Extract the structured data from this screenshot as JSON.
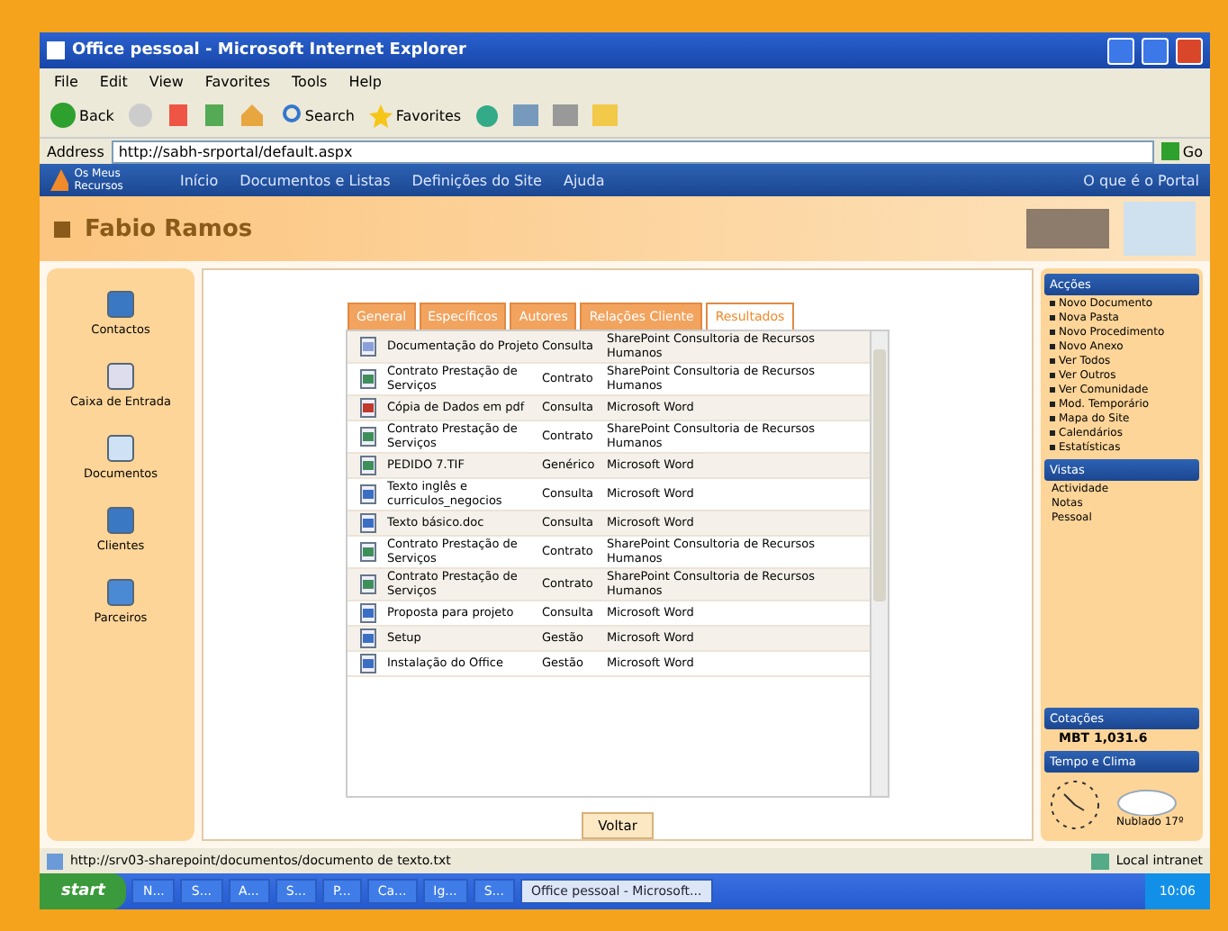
{
  "window": {
    "title": "Office pessoal - Microsoft Internet Explorer"
  },
  "menu": [
    "File",
    "Edit",
    "View",
    "Favorites",
    "Tools",
    "Help"
  ],
  "toolbar": {
    "back": "Back",
    "search": "Search",
    "favorites": "Favorites"
  },
  "address": {
    "label": "Address",
    "value": "http://sabh-srportal/default.aspx",
    "go": "Go"
  },
  "site_nav": {
    "logo": "Os Meus Recursos",
    "items": [
      "Início",
      "Documentos e Listas",
      "Definições do Site",
      "Ajuda"
    ],
    "right": "O que é o Portal"
  },
  "header": {
    "user": "Fabio Ramos"
  },
  "sidebar": {
    "items": [
      "Contactos",
      "Caixa de Entrada",
      "Documentos",
      "Clientes",
      "Parceiros"
    ]
  },
  "tabs": [
    {
      "label": "General",
      "selected": false
    },
    {
      "label": "Específicos",
      "selected": false
    },
    {
      "label": "Autores",
      "selected": false
    },
    {
      "label": "Relações Cliente",
      "selected": false
    },
    {
      "label": "Resultados",
      "selected": true
    }
  ],
  "results": [
    {
      "kind": "flag",
      "name": "Documentação do Projeto",
      "type": "Consulta",
      "source": "SharePoint Consultoria de Recursos Humanos"
    },
    {
      "kind": "sheet",
      "name": "Contrato Prestação de Serviços",
      "type": "Contrato",
      "source": "SharePoint Consultoria de Recursos Humanos"
    },
    {
      "kind": "pdf",
      "name": "Cópia de Dados em pdf",
      "type": "Consulta",
      "source": "Microsoft Word"
    },
    {
      "kind": "sheet",
      "name": "Contrato Prestação de Serviços",
      "type": "Contrato",
      "source": "SharePoint Consultoria de Recursos Humanos"
    },
    {
      "kind": "sheet",
      "name": "PEDIDO 7.TIF",
      "type": "Genérico",
      "source": "Microsoft Word"
    },
    {
      "kind": "doc",
      "name": "Texto inglês e curriculos_negocios",
      "type": "Consulta",
      "source": "Microsoft Word"
    },
    {
      "kind": "doc",
      "name": "Texto básico.doc",
      "type": "Consulta",
      "source": "Microsoft Word"
    },
    {
      "kind": "sheet",
      "name": "Contrato Prestação de Serviços",
      "type": "Contrato",
      "source": "SharePoint Consultoria de Recursos Humanos"
    },
    {
      "kind": "sheet",
      "name": "Contrato Prestação de Serviços",
      "type": "Contrato",
      "source": "SharePoint Consultoria de Recursos Humanos"
    },
    {
      "kind": "doc",
      "name": "Proposta para projeto",
      "type": "Consulta",
      "source": "Microsoft Word"
    },
    {
      "kind": "doc",
      "name": "Setup",
      "type": "Gestão",
      "source": "Microsoft Word"
    },
    {
      "kind": "doc",
      "name": "Instalação do Office",
      "type": "Gestão",
      "source": "Microsoft Word"
    }
  ],
  "back_button": "Voltar",
  "panels": [
    {
      "kind": "links",
      "title": "Acções",
      "items": [
        "Novo Documento",
        "Nova Pasta",
        "Novo Procedimento",
        "Novo Anexo",
        "Ver Todos",
        "Ver Outros",
        "Ver Comunidade",
        "Mod. Temporário",
        "Mapa do Site",
        "Calendários",
        "Estatísticas"
      ]
    },
    {
      "kind": "text",
      "title": "Vistas",
      "items": [
        "Actividade",
        "Notas",
        "Pessoal"
      ]
    },
    {
      "kind": "quote",
      "title": "Cotações",
      "items": [
        "MBT 1,031.6"
      ]
    },
    {
      "kind": "weather",
      "title": "Tempo e Clima",
      "items": [
        "Nublado 17º"
      ]
    }
  ],
  "status_bar": {
    "url": "http://srv03-sharepoint/documentos/documento de texto.txt",
    "zone": "Local intranet"
  },
  "taskbar": {
    "start": "start",
    "items": [
      "N...",
      "S...",
      "A...",
      "S...",
      "P...",
      "Ca...",
      "Ig...",
      "S..."
    ],
    "active": "Office pessoal - Microsoft...",
    "clock": "10:06"
  }
}
